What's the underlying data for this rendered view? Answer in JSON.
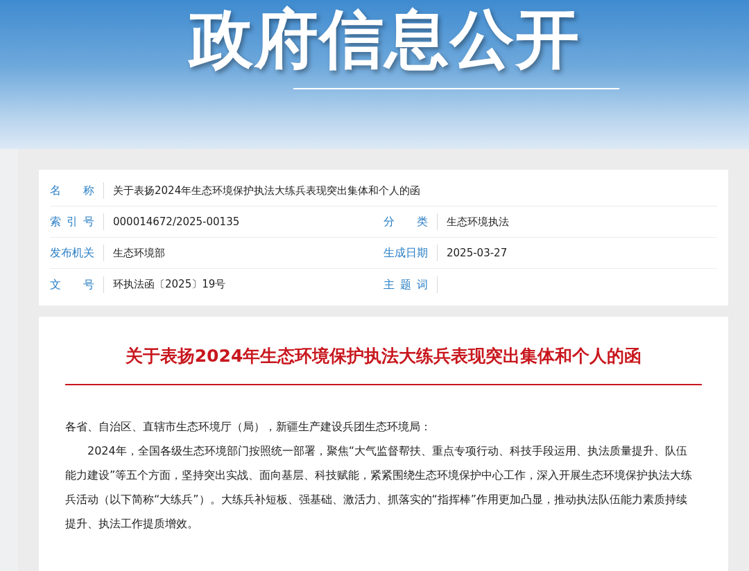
{
  "banner": {
    "title": "政府信息公开"
  },
  "info": {
    "rows": [
      [
        {
          "label": "名称",
          "value": "关于表扬2024年生态环境保护执法大练兵表现突出集体和个人的函"
        }
      ],
      [
        {
          "label": "索引号",
          "value": "000014672/2025-00135"
        },
        {
          "label": "分类",
          "value": "生态环境执法"
        }
      ],
      [
        {
          "label": "发布机关",
          "value": "生态环境部"
        },
        {
          "label": "生成日期",
          "value": "2025-03-27"
        }
      ],
      [
        {
          "label": "文号",
          "value": "环执法函〔2025〕19号"
        },
        {
          "label": "主题词"
        }
      ]
    ]
  },
  "article": {
    "title": "关于表扬2024年生态环境保护执法大练兵表现突出集体和个人的函",
    "salutation": "各省、自治区、直辖市生态环境厅（局），新疆生产建设兵团生态环境局：",
    "paragraphs": [
      "2024年，全国各级生态环境部门按照统一部署，聚焦“大气监督帮扶、重点专项行动、科技手段运用、执法质量提升、队伍能力建设”等五个方面，坚持突出实战、面向基层、科技赋能，紧紧围绕生态环境保护中心工作，深入开展生态环境保护执法大练兵活动（以下简称“大练兵”）。大练兵补短板、强基础、激活力、抓落实的“指挥棒”作用更加凸显，推动执法队伍能力素质持续提升、执法工作提质增效。"
    ]
  }
}
